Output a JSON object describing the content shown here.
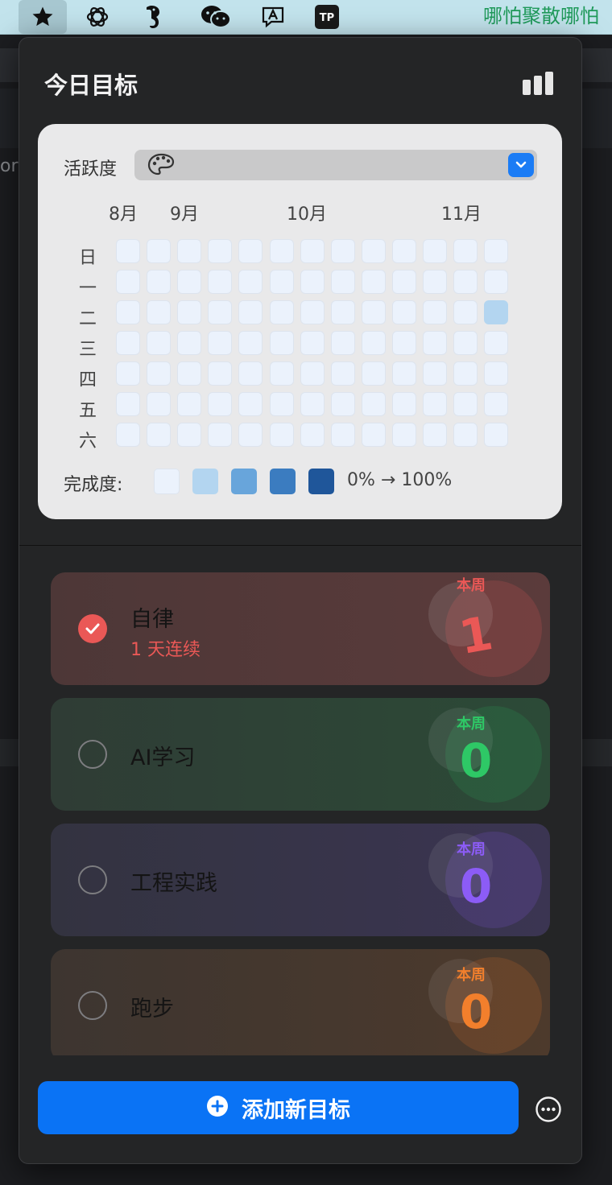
{
  "menubar": {
    "icons": [
      "star-icon",
      "openai-icon",
      "seahorse-icon",
      "wechat-icon",
      "input-method-icon",
      "typora-icon"
    ],
    "ticker_text": "哪怕聚散哪怕"
  },
  "background": {
    "left_text": "or"
  },
  "panel": {
    "title": "今日目标",
    "stats_icon": "bar-chart-icon"
  },
  "heatmap": {
    "activity_label": "活跃度",
    "select_icon": "palette-icon",
    "months": [
      "8月",
      "9月",
      "10月",
      "11月"
    ],
    "weekdays": [
      "日",
      "一",
      "二",
      "三",
      "四",
      "五",
      "六"
    ],
    "week_count": 13,
    "filled_cells": [
      {
        "week": 12,
        "day": 2,
        "level": 1
      }
    ],
    "legend_label": "完成度:",
    "legend_colors": [
      "#ebf2fc",
      "#b3d5f0",
      "#68a5db",
      "#3b7cc0",
      "#1f569a"
    ],
    "legend_range": "0% → 100%"
  },
  "goals": [
    {
      "name": "自律",
      "done": true,
      "streak": "1 天连续",
      "week_label": "本周",
      "week_count": "1",
      "color": "#ea5856"
    },
    {
      "name": "AI学习",
      "done": false,
      "streak": "",
      "week_label": "本周",
      "week_count": "0",
      "color": "#2ec866"
    },
    {
      "name": "工程实践",
      "done": false,
      "streak": "",
      "week_label": "本周",
      "week_count": "0",
      "color": "#8c5cf6"
    },
    {
      "name": "跑步",
      "done": false,
      "streak": "",
      "week_label": "本周",
      "week_count": "0",
      "color": "#f27f2c"
    }
  ],
  "footer": {
    "add_button_label": "添加新目标",
    "add_icon": "plus-circle-icon",
    "more_icon": "ellipsis-circle-icon"
  }
}
